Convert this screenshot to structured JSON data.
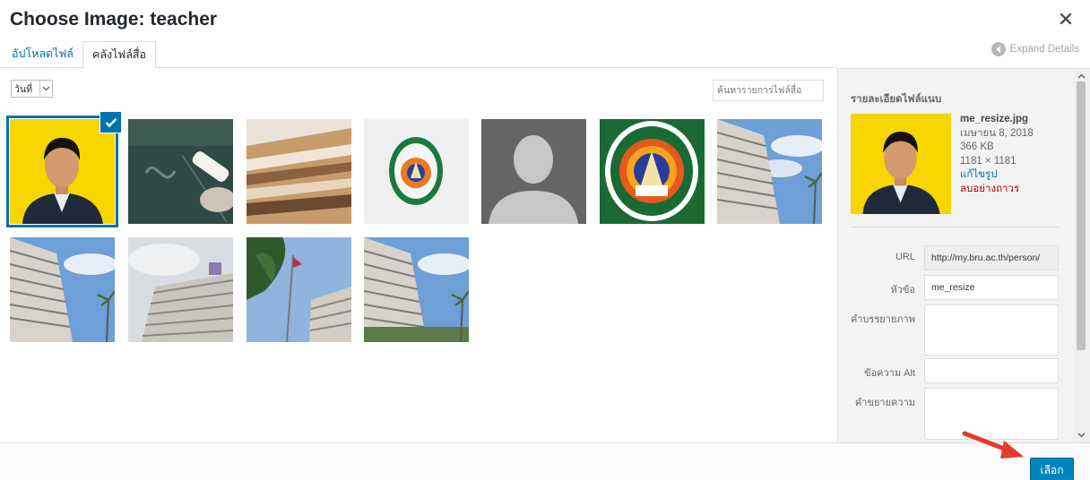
{
  "modal": {
    "title": "Choose Image: teacher",
    "close_icon": "close-icon"
  },
  "tabs": {
    "upload_label": "อัปโหลดไฟล์",
    "library_label": "คลังไฟล์สื่อ"
  },
  "expand_details": "Expand Details",
  "toolbar": {
    "date_filter_value": "วันที่",
    "search_placeholder": "ค้นหารายการไฟล์สื่อ"
  },
  "grid": {
    "items": [
      {
        "kind": "portrait",
        "selected": true
      },
      {
        "kind": "chalkboard",
        "selected": false
      },
      {
        "kind": "files",
        "selected": false
      },
      {
        "kind": "logo-small",
        "selected": false
      },
      {
        "kind": "placeholder-person",
        "selected": false
      },
      {
        "kind": "logo-large",
        "selected": false
      },
      {
        "kind": "building",
        "selected": false
      },
      {
        "kind": "building",
        "selected": false
      },
      {
        "kind": "building-white",
        "selected": false
      },
      {
        "kind": "tree-building",
        "selected": false
      },
      {
        "kind": "building",
        "selected": false
      }
    ]
  },
  "sidebar": {
    "title": "รายละเอียดไฟล์แนบ",
    "filename": "me_resize.jpg",
    "date": "เมษายน 8, 2018",
    "filesize": "366 KB",
    "dimensions": "1181 × 1181",
    "edit_label": "แก้ไขรูป",
    "delete_label": "ลบอย่างถาวร",
    "fields": {
      "url_label": "URL",
      "url_value": "http://my.bru.ac.th/person/",
      "title_label": "หัวข้อ",
      "title_value": "me_resize",
      "caption_label": "คำบรรยายภาพ",
      "caption_value": "",
      "alt_label": "ข้อความ Alt",
      "alt_value": "",
      "description_label": "คำขยายความ",
      "description_value": ""
    }
  },
  "footer": {
    "select_label": "เลือก"
  },
  "colors": {
    "primary": "#0085ba",
    "link": "#0073aa",
    "delete": "#a00000",
    "annotation_arrow": "#e8382d",
    "portrait_bg": "#f7d600"
  }
}
